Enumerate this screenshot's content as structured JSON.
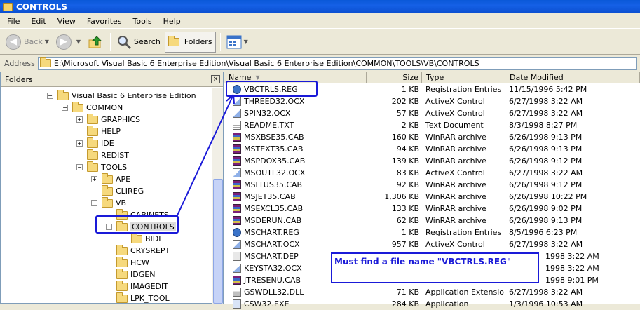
{
  "window": {
    "title": "CONTROLS"
  },
  "menu": [
    "File",
    "Edit",
    "View",
    "Favorites",
    "Tools",
    "Help"
  ],
  "toolbar": {
    "back": "Back",
    "search": "Search",
    "folders": "Folders"
  },
  "address": {
    "label": "Address",
    "path": "E:\\Microsoft Visual Basic 6 Enterprise Edition\\Visual Basic 6 Enterprise Edition\\COMMON\\TOOLS\\VB\\CONTROLS"
  },
  "folders_pane": {
    "title": "Folders",
    "close": "×"
  },
  "tree": [
    {
      "label": "Visual Basic 6 Enterprise Edition",
      "level": 0,
      "toggle": "−"
    },
    {
      "label": "COMMON",
      "level": 1,
      "toggle": "−"
    },
    {
      "label": "GRAPHICS",
      "level": 2,
      "toggle": "+"
    },
    {
      "label": "HELP",
      "level": 2,
      "toggle": ""
    },
    {
      "label": "IDE",
      "level": 2,
      "toggle": "+"
    },
    {
      "label": "REDIST",
      "level": 2,
      "toggle": ""
    },
    {
      "label": "TOOLS",
      "level": 2,
      "toggle": "−"
    },
    {
      "label": "APE",
      "level": 3,
      "toggle": "+"
    },
    {
      "label": "CLIREG",
      "level": 3,
      "toggle": ""
    },
    {
      "label": "VB",
      "level": 3,
      "toggle": "−"
    },
    {
      "label": "CABINETS",
      "level": 4,
      "toggle": ""
    },
    {
      "label": "CONTROLS",
      "level": 4,
      "toggle": "−",
      "selected": true
    },
    {
      "label": "BIDI",
      "level": 5,
      "toggle": ""
    },
    {
      "label": "CRYSREPT",
      "level": 4,
      "toggle": ""
    },
    {
      "label": "HCW",
      "level": 4,
      "toggle": ""
    },
    {
      "label": "IDGEN",
      "level": 4,
      "toggle": ""
    },
    {
      "label": "IMAGEDIT",
      "level": 4,
      "toggle": ""
    },
    {
      "label": "LPK_TOOL",
      "level": 4,
      "toggle": ""
    }
  ],
  "columns": {
    "name": "Name",
    "size": "Size",
    "type": "Type",
    "modified": "Date Modified"
  },
  "files": [
    {
      "name": "VBCTRLS.REG",
      "size": "1 KB",
      "type": "Registration Entries",
      "modified": "11/15/1996 5:42 PM",
      "icon": "reg"
    },
    {
      "name": "THREED32.OCX",
      "size": "202 KB",
      "type": "ActiveX Control",
      "modified": "6/27/1998 3:22 AM",
      "icon": "ocx"
    },
    {
      "name": "SPIN32.OCX",
      "size": "57 KB",
      "type": "ActiveX Control",
      "modified": "6/27/1998 3:22 AM",
      "icon": "ocx"
    },
    {
      "name": "README.TXT",
      "size": "2 KB",
      "type": "Text Document",
      "modified": "8/3/1998 8:27 PM",
      "icon": "txt"
    },
    {
      "name": "MSXBSE35.CAB",
      "size": "160 KB",
      "type": "WinRAR archive",
      "modified": "6/26/1998 9:13 PM",
      "icon": "cab"
    },
    {
      "name": "MSTEXT35.CAB",
      "size": "94 KB",
      "type": "WinRAR archive",
      "modified": "6/26/1998 9:13 PM",
      "icon": "cab"
    },
    {
      "name": "MSPDOX35.CAB",
      "size": "139 KB",
      "type": "WinRAR archive",
      "modified": "6/26/1998 9:12 PM",
      "icon": "cab"
    },
    {
      "name": "MSOUTL32.OCX",
      "size": "83 KB",
      "type": "ActiveX Control",
      "modified": "6/27/1998 3:22 AM",
      "icon": "ocx"
    },
    {
      "name": "MSLTUS35.CAB",
      "size": "92 KB",
      "type": "WinRAR archive",
      "modified": "6/26/1998 9:12 PM",
      "icon": "cab"
    },
    {
      "name": "MSJET35.CAB",
      "size": "1,306 KB",
      "type": "WinRAR archive",
      "modified": "6/26/1998 10:22 PM",
      "icon": "cab"
    },
    {
      "name": "MSEXCL35.CAB",
      "size": "133 KB",
      "type": "WinRAR archive",
      "modified": "6/26/1998 9:02 PM",
      "icon": "cab"
    },
    {
      "name": "MSDERUN.CAB",
      "size": "62 KB",
      "type": "WinRAR archive",
      "modified": "6/26/1998 9:13 PM",
      "icon": "cab"
    },
    {
      "name": "MSCHART.REG",
      "size": "1 KB",
      "type": "Registration Entries",
      "modified": "8/5/1996 6:23 PM",
      "icon": "reg"
    },
    {
      "name": "MSCHART.OCX",
      "size": "957 KB",
      "type": "ActiveX Control",
      "modified": "6/27/1998 3:22 AM",
      "icon": "ocx"
    },
    {
      "name": "MSCHART.DEP",
      "size": "",
      "type": "",
      "modified": "1998 3:22 AM",
      "icon": "dep"
    },
    {
      "name": "KEYSTA32.OCX",
      "size": "",
      "type": "",
      "modified": "1998 3:22 AM",
      "icon": "ocx"
    },
    {
      "name": "JTRESENU.CAB",
      "size": "",
      "type": "",
      "modified": "1998 9:01 PM",
      "icon": "cab"
    },
    {
      "name": "GSWDLL32.DLL",
      "size": "71 KB",
      "type": "Application Extension",
      "modified": "6/27/1998 3:22 AM",
      "icon": "dll"
    },
    {
      "name": "CSW32.EXE",
      "size": "284 KB",
      "type": "Application",
      "modified": "1/3/1996 10:53 AM",
      "icon": "exe"
    }
  ],
  "annotation": {
    "note": "Must find a file name \"VBCTRLS.REG\"",
    "color": "#1a1ad8"
  }
}
